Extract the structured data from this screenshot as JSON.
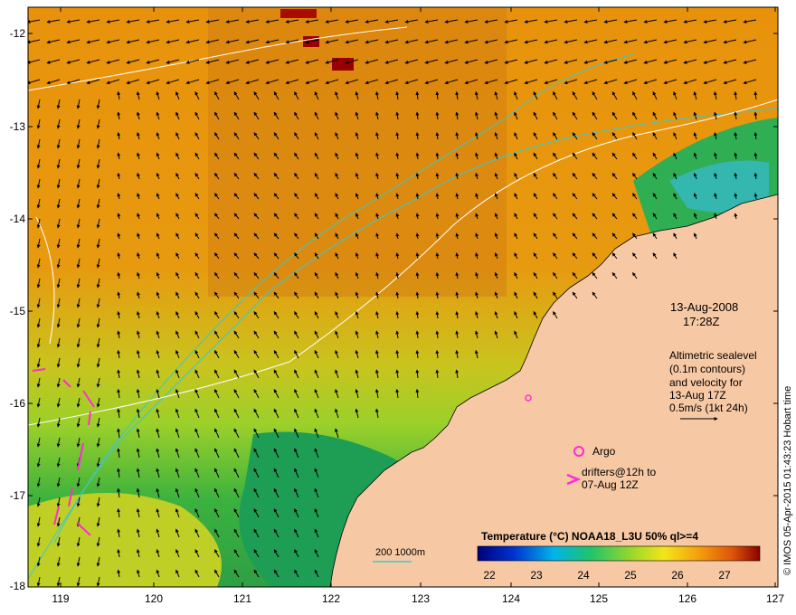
{
  "map": {
    "lon_ticks": [
      "119",
      "120",
      "121",
      "122",
      "123",
      "124",
      "125",
      "126",
      "127"
    ],
    "lat_ticks": [
      "-12",
      "-13",
      "-14",
      "-15",
      "-16",
      "-17",
      "-18"
    ],
    "lon_range": [
      118.65,
      127.0
    ],
    "lat_range": [
      -18.0,
      -11.75
    ]
  },
  "annotations": {
    "date": "13-Aug-2008",
    "time": "17:28Z",
    "alt_line1": "Altimetric sealevel",
    "alt_line2": "(0.1m contours)",
    "alt_line3": "and velocity for",
    "alt_line4": "13-Aug 17Z",
    "alt_line5": "0.5m/s (1kt 24h)",
    "argo_label": "Argo",
    "drifters_line1": "drifters@12h to",
    "drifters_line2": "07-Aug 12Z",
    "isobath_label": "200  1000m"
  },
  "colorbar": {
    "title": "Temperature (°C) NOAA18_L3U 50% ql>=4",
    "ticks": [
      "22",
      "23",
      "24",
      "25",
      "26",
      "27"
    ]
  },
  "credit": "© IMOS 05-Apr-2015 01:43:23 Hobart time",
  "colors": {
    "land": "#f7c8a4",
    "sst_warm": "#e8940a",
    "sst_cool": "#1ea64a",
    "isobath": "#3fc7c7",
    "contour": "#ffffff",
    "drifter": "#ff2bd6",
    "hot_patch": "#990000"
  }
}
